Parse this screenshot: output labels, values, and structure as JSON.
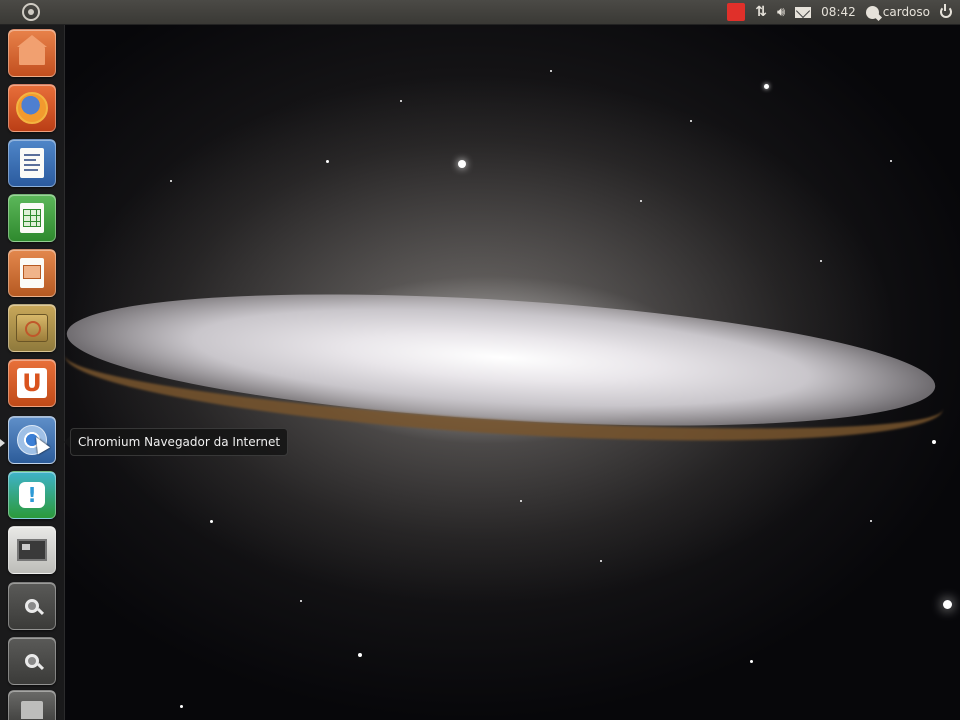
{
  "panel": {
    "clock": "08:42",
    "username": "cardoso"
  },
  "launcher": {
    "tooltip": "Chromium Navegador da Internet",
    "items": [
      {
        "icon": "home-folder-icon"
      },
      {
        "icon": "firefox-icon"
      },
      {
        "icon": "libreoffice-writer-icon"
      },
      {
        "icon": "libreoffice-calc-icon"
      },
      {
        "icon": "libreoffice-impress-icon"
      },
      {
        "icon": "software-center-icon"
      },
      {
        "icon": "ubuntu-one-icon",
        "glyph": "U"
      },
      {
        "icon": "chromium-icon"
      },
      {
        "icon": "gwibber-icon",
        "glyph": "!"
      },
      {
        "icon": "workspace-switcher-icon"
      },
      {
        "icon": "applications-lens-icon"
      },
      {
        "icon": "files-lens-icon"
      },
      {
        "icon": "trash-icon"
      }
    ]
  },
  "colors": {
    "panel_bg": "#3f3e3a",
    "accent_orange": "#dd4814",
    "indicator_red": "#e0302a"
  }
}
